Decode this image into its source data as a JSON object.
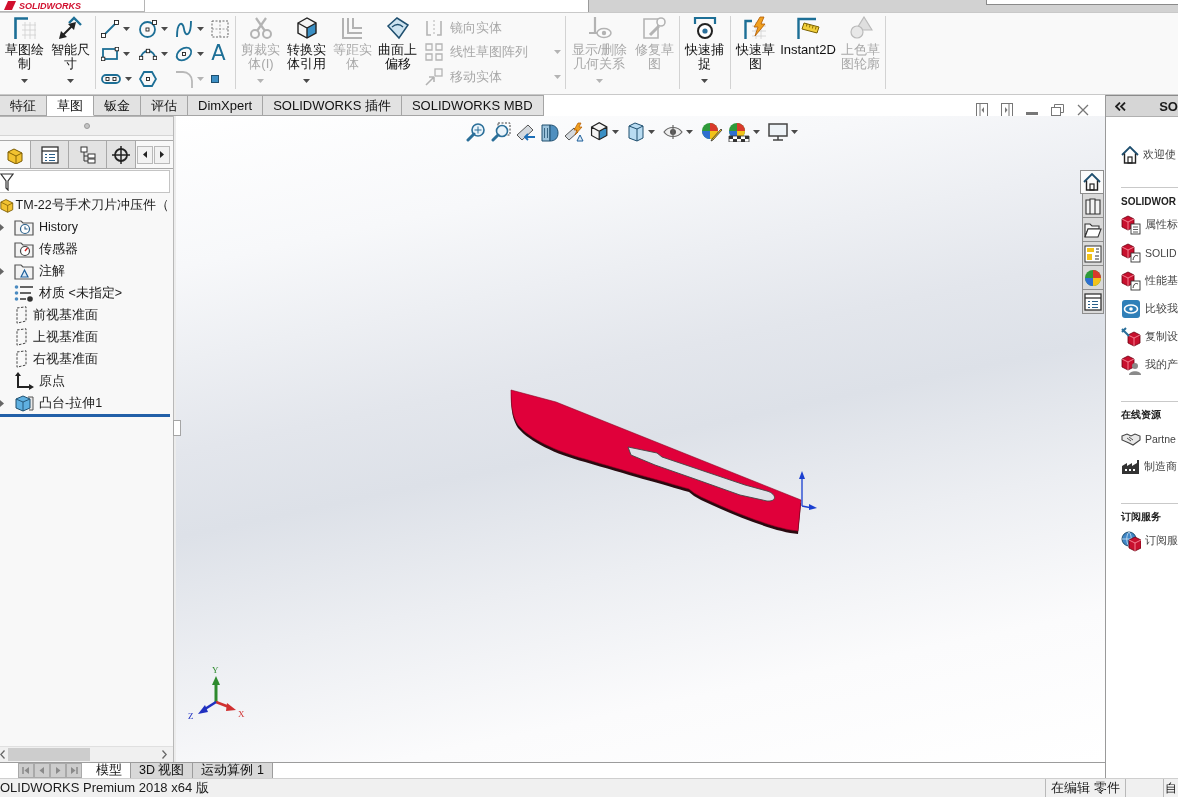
{
  "app_logo": "SOLIDWORKS",
  "command_manager": {
    "groups": [
      {
        "buttons": [
          {
            "kind": "sketch",
            "label": "草图绘制",
            "disabled": false,
            "dropdown": true
          },
          {
            "kind": "dimension",
            "label": "智能尺寸",
            "disabled": false,
            "dropdown": true
          }
        ]
      },
      {
        "grid": [
          {
            "kind": "line",
            "disabled": false,
            "dropdown": true
          },
          {
            "kind": "circle",
            "disabled": false,
            "dropdown": true
          },
          {
            "kind": "spline",
            "disabled": false,
            "dropdown": true
          },
          {
            "kind": "construction",
            "disabled": false,
            "dropdown": false
          },
          {
            "kind": "rectangle",
            "disabled": false,
            "dropdown": true
          },
          {
            "kind": "arc",
            "disabled": false,
            "dropdown": true
          },
          {
            "kind": "ellipse",
            "disabled": false,
            "dropdown": true
          },
          {
            "kind": "text",
            "label": "A",
            "disabled": false,
            "dropdown": false
          },
          {
            "kind": "slot",
            "disabled": false,
            "dropdown": true
          },
          {
            "kind": "polygon",
            "disabled": false,
            "dropdown": false
          },
          {
            "kind": "fillet",
            "disabled": true,
            "dropdown": true
          },
          {
            "kind": "point",
            "disabled": false,
            "dropdown": false
          }
        ]
      },
      {
        "buttons": [
          {
            "kind": "trim",
            "label": "剪裁实体(I)",
            "disabled": true,
            "dropdown": true
          },
          {
            "kind": "convert",
            "label": "转换实体引用",
            "disabled": false,
            "dropdown": true
          },
          {
            "kind": "offset",
            "label": "等距实体",
            "disabled": true,
            "dropdown": false
          },
          {
            "kind": "surfaceoffset",
            "label": "曲面上偏移",
            "disabled": false,
            "dropdown": false
          }
        ],
        "list": [
          {
            "kind": "mirror",
            "label": "镜向实体",
            "disabled": true,
            "dropdown": false
          },
          {
            "kind": "pattern",
            "label": "线性草图阵列",
            "disabled": true,
            "dropdown": true
          },
          {
            "kind": "move",
            "label": "移动实体",
            "disabled": true,
            "dropdown": true
          }
        ]
      },
      {
        "buttons": [
          {
            "kind": "relations",
            "label": "显示/删除几何关系",
            "disabled": true,
            "dropdown": true
          },
          {
            "kind": "repair",
            "label": "修复草图",
            "disabled": true,
            "dropdown": false
          }
        ]
      },
      {
        "buttons": [
          {
            "kind": "quicksnap",
            "label": "快速捕捉",
            "disabled": false,
            "dropdown": true
          }
        ]
      },
      {
        "buttons": [
          {
            "kind": "rapid",
            "label": "快速草图",
            "disabled": false,
            "dropdown": false
          },
          {
            "kind": "instant2d",
            "label": "Instant2D",
            "disabled": false,
            "dropdown": false
          },
          {
            "kind": "shaded",
            "label": "上色草图轮廓",
            "disabled": true,
            "dropdown": false
          }
        ]
      }
    ]
  },
  "tabs": [
    {
      "label": "特征",
      "selected": false
    },
    {
      "label": "草图",
      "selected": true
    },
    {
      "label": "钣金",
      "selected": false
    },
    {
      "label": "评估",
      "selected": false
    },
    {
      "label": "DimXpert",
      "selected": false
    },
    {
      "label": "SOLIDWORKS 插件",
      "selected": false
    },
    {
      "label": "SOLIDWORKS MBD",
      "selected": false
    }
  ],
  "panel_tabs": [
    {
      "kind": "part",
      "selected": true
    },
    {
      "kind": "properties",
      "selected": false
    },
    {
      "kind": "configurations",
      "selected": false
    },
    {
      "kind": "dimxpert",
      "selected": false
    }
  ],
  "feature_tree": {
    "root": {
      "label": "TM-22号手术刀片冲压件（",
      "children": [
        {
          "kind": "history",
          "label": "History",
          "expandable": true
        },
        {
          "kind": "sensors",
          "label": "传感器",
          "expandable": false
        },
        {
          "kind": "annotations",
          "label": "注解",
          "expandable": true
        },
        {
          "kind": "material",
          "label": "材质 <未指定>",
          "expandable": false
        },
        {
          "kind": "plane",
          "label": "前视基准面",
          "expandable": false
        },
        {
          "kind": "plane",
          "label": "上视基准面",
          "expandable": false
        },
        {
          "kind": "plane",
          "label": "右视基准面",
          "expandable": false
        },
        {
          "kind": "origin",
          "label": "原点",
          "expandable": false
        },
        {
          "kind": "extrude",
          "label": "凸台-拉伸1",
          "expandable": true
        }
      ]
    }
  },
  "triad": {
    "y": "Y",
    "x": "X",
    "z": "Z"
  },
  "task_tabs": [
    {
      "kind": "home",
      "selected": true
    },
    {
      "kind": "library",
      "selected": false
    },
    {
      "kind": "explorer",
      "selected": false
    },
    {
      "kind": "viewpalette",
      "selected": false
    },
    {
      "kind": "appearance",
      "selected": false
    },
    {
      "kind": "properties",
      "selected": false
    }
  ],
  "model_tabs": [
    {
      "label": "模型",
      "selected": true
    },
    {
      "label": "3D 视图",
      "selected": false
    },
    {
      "label": "运动算例 1",
      "selected": false
    }
  ],
  "task_pane": {
    "title": "SO",
    "welcome": {
      "kind": "home",
      "label": "欢迎使"
    },
    "sections": [
      {
        "title": "SOLIDWOR",
        "items": [
          {
            "kind": "docprops",
            "label": "属性标"
          },
          {
            "kind": "cubetile",
            "label": "SOLID"
          },
          {
            "kind": "cubetile",
            "label": "性能基"
          },
          {
            "kind": "compare",
            "label": "比较我"
          },
          {
            "kind": "copy",
            "label": "复制设"
          },
          {
            "kind": "products",
            "label": "我的产"
          }
        ]
      },
      {
        "title": "在线资源",
        "items": [
          {
            "kind": "partner",
            "label": "Partne"
          },
          {
            "kind": "factory",
            "label": "制造商"
          }
        ]
      },
      {
        "title": "订阅服务",
        "items": [
          {
            "kind": "subscription",
            "label": "订阅服"
          }
        ]
      }
    ]
  },
  "status_bar": {
    "left": "OLIDWORKS Premium 2018 x64 版",
    "mode": "在编辑 零件",
    "extra": "自"
  }
}
